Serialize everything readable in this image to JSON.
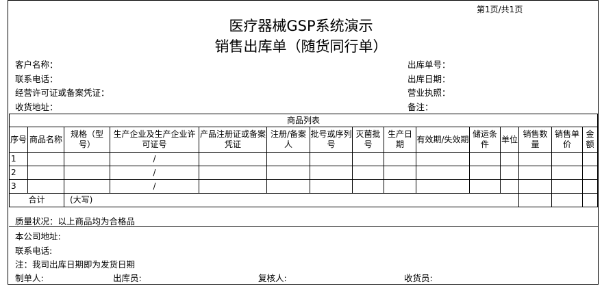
{
  "page_number": "第1页/共1页",
  "title": "医疗器械GSP系统演示",
  "subtitle": "销售出库单（随货同行单）",
  "left_fields": [
    {
      "label": "客户名称："
    },
    {
      "label": "联系电话："
    },
    {
      "label": "经营许可证或备案凭证："
    },
    {
      "label": "收货地址："
    }
  ],
  "right_fields": [
    {
      "label": "出库单号："
    },
    {
      "label": "出库日期："
    },
    {
      "label": "营业执照："
    },
    {
      "label": "备注："
    }
  ],
  "table": {
    "caption": "商品列表",
    "headers": [
      "序号",
      "商品名称",
      "规格（型号）",
      "生产企业及生产企业许可证号",
      "产品注册证或备案凭证",
      "注册/备案人",
      "批号或序列号",
      "灭菌批号",
      "生产日期",
      "有效期/失效期",
      "储运条件",
      "单位",
      "销售数量",
      "销售单价",
      "金额"
    ],
    "rows": [
      [
        "1",
        "",
        "",
        "/",
        "",
        "",
        "",
        "",
        "",
        "",
        "",
        "",
        "",
        "",
        ""
      ],
      [
        "2",
        "",
        "",
        "/",
        "",
        "",
        "",
        "",
        "",
        "",
        "",
        "",
        "",
        "",
        ""
      ],
      [
        "3",
        "",
        "",
        "/",
        "",
        "",
        "",
        "",
        "",
        "",
        "",
        "",
        "",
        "",
        ""
      ]
    ],
    "total_label": "合计",
    "total_uppercase": "(大写)"
  },
  "quality": "质量状况：以上商品均为合格品",
  "company_address": "本公司地址:",
  "company_phone": "联系电话:",
  "note": "注：我司出库日期即为发货日期",
  "signatures": {
    "maker": "制单人:",
    "shipper": "出库员:",
    "reviewer": "复核人:",
    "receiver": "收货员:"
  }
}
